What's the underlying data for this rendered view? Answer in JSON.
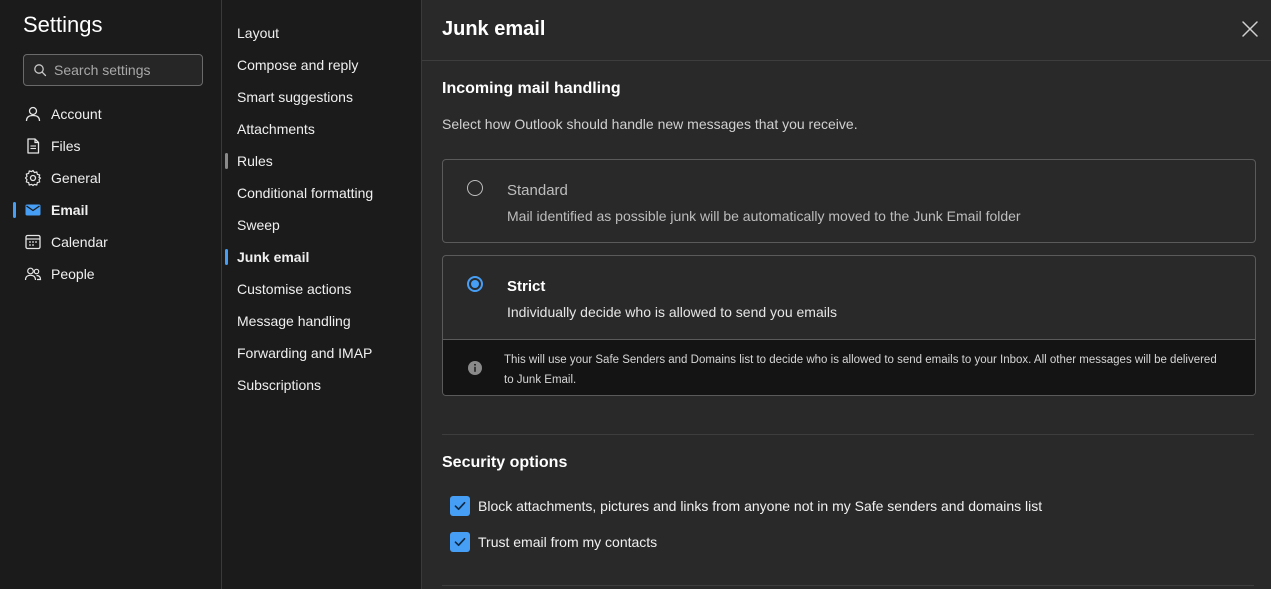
{
  "sidebar": {
    "title": "Settings",
    "search_placeholder": "Search settings",
    "items": [
      {
        "label": "Account"
      },
      {
        "label": "Files"
      },
      {
        "label": "General"
      },
      {
        "label": "Email"
      },
      {
        "label": "Calendar"
      },
      {
        "label": "People"
      }
    ],
    "active_index": 3
  },
  "subnav": {
    "items": [
      {
        "label": "Layout"
      },
      {
        "label": "Compose and reply"
      },
      {
        "label": "Smart suggestions"
      },
      {
        "label": "Attachments"
      },
      {
        "label": "Rules"
      },
      {
        "label": "Conditional formatting"
      },
      {
        "label": "Sweep"
      },
      {
        "label": "Junk email"
      },
      {
        "label": "Customise actions"
      },
      {
        "label": "Message handling"
      },
      {
        "label": "Forwarding and IMAP"
      },
      {
        "label": "Subscriptions"
      }
    ],
    "active_index": 7
  },
  "main": {
    "title": "Junk email",
    "incoming": {
      "title": "Incoming mail handling",
      "description": "Select how Outlook should handle new messages that you receive.",
      "options": [
        {
          "label": "Standard",
          "description": "Mail identified as possible junk will be automatically moved to the Junk Email folder",
          "selected": false
        },
        {
          "label": "Strict",
          "description": "Individually decide who is allowed to send you emails",
          "selected": true,
          "info": "This will use your Safe Senders and Domains list to decide who is allowed to send emails to your Inbox. All other messages will be delivered to Junk Email."
        }
      ]
    },
    "security": {
      "title": "Security options",
      "checkboxes": [
        {
          "label": "Block attachments, pictures and links from anyone not in my Safe senders and domains list",
          "checked": true
        },
        {
          "label": "Trust email from my contacts",
          "checked": true
        }
      ]
    }
  },
  "colors": {
    "accent": "#479ef5",
    "background": "#292929",
    "nav_background": "#1b1b1b"
  },
  "icons": {
    "search": "search-icon",
    "account": "person-icon",
    "files": "document-icon",
    "general": "gear-icon",
    "email": "mail-icon",
    "calendar": "calendar-icon",
    "people": "people-icon",
    "close": "close-icon",
    "info": "info-icon",
    "check": "checkmark-icon"
  }
}
